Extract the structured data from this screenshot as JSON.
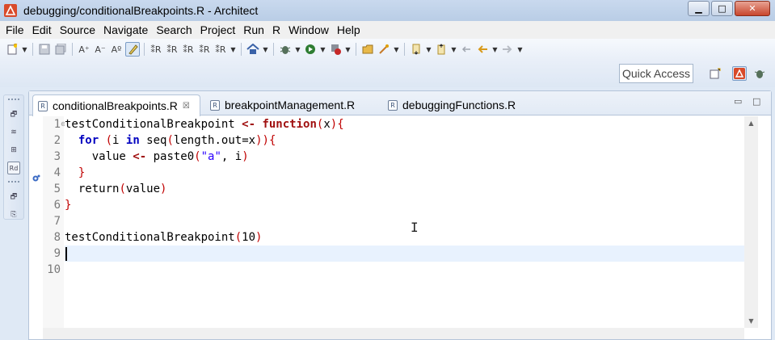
{
  "window": {
    "title": "debugging/conditionalBreakpoints.R - Architect",
    "minimize_glyph": "▁",
    "maximize_glyph": "□",
    "close_glyph": "✕"
  },
  "menu": [
    "File",
    "Edit",
    "Source",
    "Navigate",
    "Search",
    "Project",
    "Run",
    "R",
    "Window",
    "Help"
  ],
  "toolbar": {
    "icons": [
      "new-icon",
      "save-icon",
      "save-all-icon",
      "font-increase-icon",
      "font-decrease-icon",
      "font-reset-icon",
      "highlight-icon",
      "r-run-icon",
      "r-run-all-icon",
      "r-run-line-icon",
      "r-source-icon",
      "r-console-icon",
      "home-icon",
      "debug-icon",
      "run-icon",
      "stop-icon",
      "open-folder-icon",
      "wand-icon",
      "next-annotation-icon",
      "prev-annotation-icon",
      "last-edit-icon",
      "back-icon",
      "forward-icon"
    ],
    "glyphs": {
      "font_increase": "A⁺",
      "font_decrease": "A⁻",
      "font_reset": "Aº",
      "r_run": "⁑R"
    }
  },
  "quick_access": {
    "placeholder": "Quick Access"
  },
  "side_trim": {
    "glyphs": [
      "🗗",
      "≋",
      "⊞",
      "Rd",
      "🗗",
      "⎘"
    ]
  },
  "editor": {
    "tabs": [
      {
        "label": "conditionalBreakpoints.R",
        "active": true,
        "close_glyph": "☒"
      },
      {
        "label": "breakpointManagement.R",
        "active": false
      },
      {
        "label": "debuggingFunctions.R",
        "active": false
      }
    ],
    "r_icon_letter": "R",
    "minimize_glyph": "▭",
    "maximize_glyph": "□",
    "fold_glyph": "⊖",
    "line_numbers": [
      "1",
      "2",
      "3",
      "4",
      "5",
      "6",
      "7",
      "8",
      "9",
      "10"
    ],
    "current_line": 9,
    "scroll_up_glyph": "▲",
    "scroll_down_glyph": "▼",
    "ibeam_glyph": "I"
  },
  "code": {
    "l1": {
      "name": "testConditionalBreakpoint",
      "assign": " <- ",
      "kw": "function",
      "open": "(",
      "arg": "x",
      "close": ")",
      "brace": "{"
    },
    "l2": {
      "indent": "  ",
      "kw": "for",
      "sp": " ",
      "open": "(",
      "var": "i ",
      "kw2": "in",
      "call": " seq",
      "open2": "(",
      "args": "length.out=x",
      "close2": ")",
      "close": ")",
      "brace": "{"
    },
    "l3": {
      "indent": "    ",
      "text1": "value ",
      "assign": "<-",
      "call": " paste0",
      "open": "(",
      "str": "\"a\"",
      "rest": ", i",
      "close": ")"
    },
    "l4": {
      "indent": "  ",
      "brace": "}"
    },
    "l5": {
      "indent": "  ",
      "call": "return",
      "open": "(",
      "arg": "value",
      "close": ")"
    },
    "l6": {
      "brace": "}"
    },
    "l8": {
      "call": "testConditionalBreakpoint",
      "open": "(",
      "num": "10",
      "close": ")"
    }
  },
  "colors": {
    "keyword": "#a01010",
    "keyword_in": "#0000c0",
    "bracket": "#c00000",
    "string": "#2a00ff",
    "current_line": "#e8f2fe"
  }
}
